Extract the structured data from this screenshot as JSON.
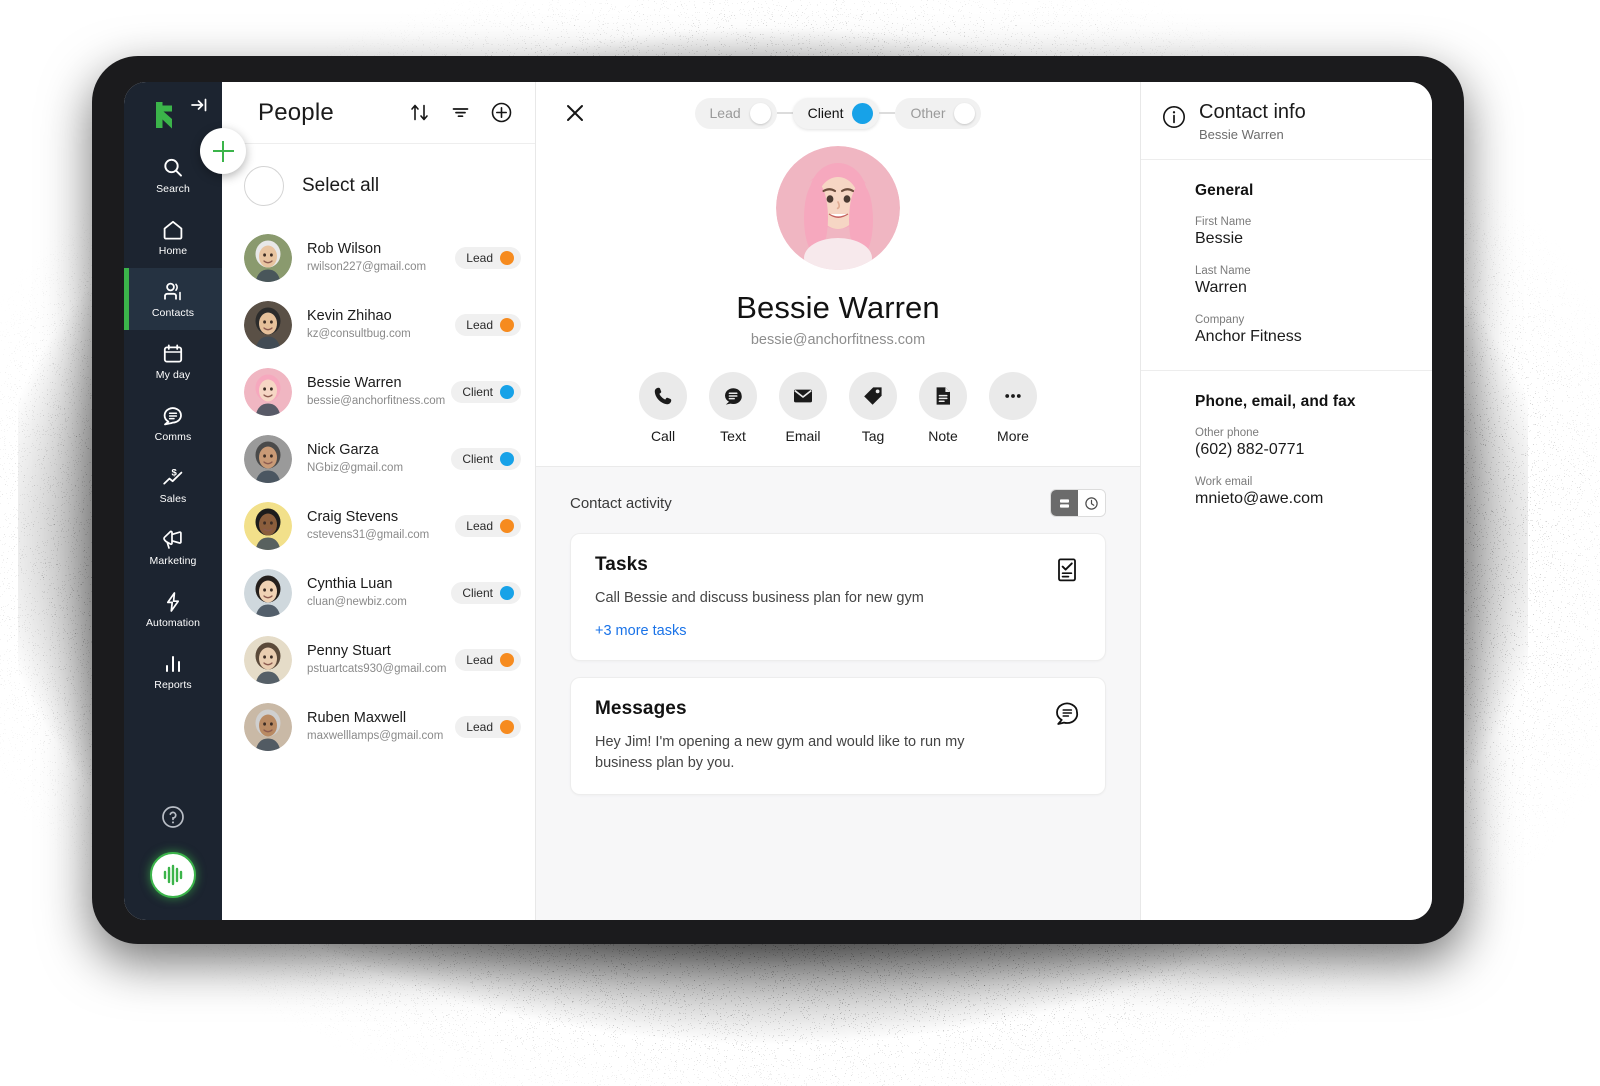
{
  "sidebar": {
    "logo_name": "keap-logo",
    "collapse_label": "collapse-panel",
    "items": [
      {
        "label": "Search",
        "icon": "search-icon",
        "active": false
      },
      {
        "label": "Home",
        "icon": "home-icon",
        "active": false
      },
      {
        "label": "Contacts",
        "icon": "contacts-icon",
        "active": true
      },
      {
        "label": "My day",
        "icon": "calendar-icon",
        "active": false
      },
      {
        "label": "Comms",
        "icon": "chat-icon",
        "active": false
      },
      {
        "label": "Sales",
        "icon": "sales-chart-icon",
        "active": false
      },
      {
        "label": "Marketing",
        "icon": "megaphone-icon",
        "active": false
      },
      {
        "label": "Automation",
        "icon": "lightning-bolt-icon",
        "active": false
      },
      {
        "label": "Reports",
        "icon": "bar-chart-icon",
        "active": false
      }
    ],
    "help_icon": "question-circle-icon",
    "brand_avatar_icon": "audio-waveform-icon",
    "add_button_icon": "plus-icon",
    "accent_green": "#3bb44a",
    "background": "#1c2430"
  },
  "people": {
    "title": "People",
    "tools": [
      {
        "name": "sort-icon",
        "label": "Sort"
      },
      {
        "name": "filter-icon",
        "label": "Filter"
      },
      {
        "name": "add-contact-icon",
        "label": "Add contact"
      }
    ],
    "select_all_label": "Select all",
    "contacts": [
      {
        "name": "Rob Wilson",
        "email": "rwilson227@gmail.com",
        "status": "Lead",
        "status_color": "#f68b1f",
        "avatar_bg": "#8a9a6e"
      },
      {
        "name": "Kevin Zhihao",
        "email": "kz@consultbug.com",
        "status": "Lead",
        "status_color": "#f68b1f",
        "avatar_bg": "#5a5046"
      },
      {
        "name": "Bessie Warren",
        "email": "bessie@anchorfitness.com",
        "status": "Client",
        "status_color": "#17a2e8",
        "avatar_bg": "#f0b6c2"
      },
      {
        "name": "Nick Garza",
        "email": "NGbiz@gmail.com",
        "status": "Client",
        "status_color": "#17a2e8",
        "avatar_bg": "#9a9a9a"
      },
      {
        "name": "Craig Stevens",
        "email": "cstevens31@gmail.com",
        "status": "Lead",
        "status_color": "#f68b1f",
        "avatar_bg": "#f2e08a"
      },
      {
        "name": "Cynthia Luan",
        "email": "cluan@newbiz.com",
        "status": "Client",
        "status_color": "#17a2e8",
        "avatar_bg": "#cfd8dd"
      },
      {
        "name": "Penny Stuart",
        "email": "pstuartcats930@gmail.com",
        "status": "Lead",
        "status_color": "#f68b1f",
        "avatar_bg": "#e5dcc8"
      },
      {
        "name": "Ruben Maxwell",
        "email": "maxwelllamps@gmail.com",
        "status": "Lead",
        "status_color": "#f68b1f",
        "avatar_bg": "#c9b9a6"
      }
    ]
  },
  "detail": {
    "close_icon": "close-icon",
    "segments": [
      {
        "label": "Lead",
        "active": false
      },
      {
        "label": "Client",
        "active": true
      },
      {
        "label": "Other",
        "active": false
      }
    ],
    "active_segment_color": "#17a2e8",
    "contact_name": "Bessie Warren",
    "contact_email": "bessie@anchorfitness.com",
    "avatar_bg": "#f0b6c2",
    "actions": [
      {
        "label": "Call",
        "icon": "phone-icon"
      },
      {
        "label": "Text",
        "icon": "message-icon"
      },
      {
        "label": "Email",
        "icon": "envelope-icon"
      },
      {
        "label": "Tag",
        "icon": "tag-icon"
      },
      {
        "label": "Note",
        "icon": "document-icon"
      },
      {
        "label": "More",
        "icon": "ellipsis-icon"
      }
    ],
    "activity": {
      "title": "Contact activity",
      "view_toggle": [
        {
          "name": "list-view-icon",
          "active": true
        },
        {
          "name": "clock-history-icon",
          "active": false
        }
      ],
      "cards": [
        {
          "title": "Tasks",
          "body": "Call Bessie and discuss business plan for new gym",
          "link": "+3 more tasks",
          "icon": "checklist-icon"
        },
        {
          "title": "Messages",
          "body": "Hey Jim! I'm opening a new gym and would like to run my business plan by you.",
          "link": "",
          "icon": "speech-bubble-icon"
        }
      ]
    }
  },
  "info": {
    "icon": "info-circle-icon",
    "title": "Contact info",
    "subtitle": "Bessie Warren",
    "sections": [
      {
        "title": "General",
        "fields": [
          {
            "label": "First Name",
            "value": "Bessie"
          },
          {
            "label": "Last Name",
            "value": "Warren"
          },
          {
            "label": "Company",
            "value": "Anchor Fitness"
          }
        ]
      },
      {
        "title": "Phone, email, and fax",
        "fields": [
          {
            "label": "Other phone",
            "value": "(602) 882-0771"
          },
          {
            "label": "Work email",
            "value": "mnieto@awe.com"
          }
        ]
      }
    ]
  }
}
